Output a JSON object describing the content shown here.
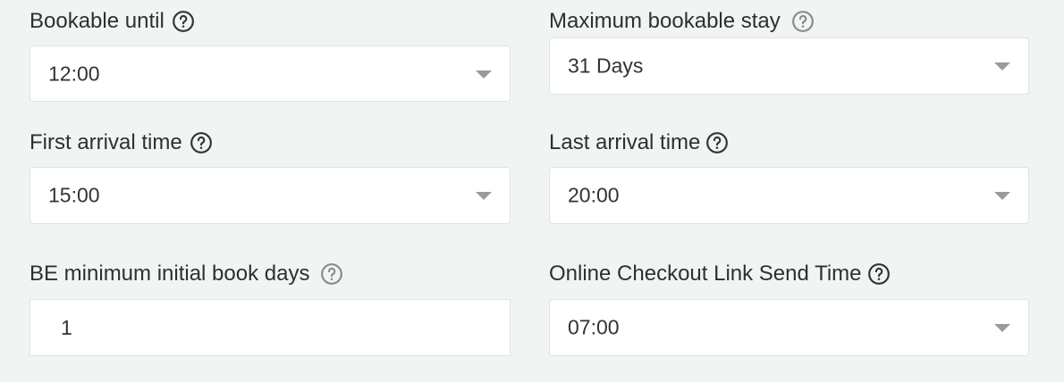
{
  "fields": {
    "bookable_until": {
      "label": "Bookable until",
      "value": "12:00",
      "help_icon": "help-circle-icon"
    },
    "max_bookable_stay": {
      "label": "Maximum bookable stay",
      "value": "31 Days",
      "help_icon": "help-circle-icon"
    },
    "first_arrival_time": {
      "label": "First arrival time",
      "value": "15:00",
      "help_icon": "help-circle-icon"
    },
    "last_arrival_time": {
      "label": "Last arrival time",
      "value": "20:00",
      "help_icon": "help-circle-icon"
    },
    "be_min_initial_book_days": {
      "label": "BE minimum initial book days",
      "value": "1",
      "help_icon": "help-circle-icon"
    },
    "online_checkout_link_send_time": {
      "label": "Online Checkout Link Send Time",
      "value": "07:00",
      "help_icon": "help-circle-icon"
    }
  },
  "colors": {
    "background": "#f0f5f4",
    "field_background": "#ffffff",
    "field_border": "#dde4e2",
    "caret": "#9a9a9a",
    "text": "#2f2f2f"
  }
}
